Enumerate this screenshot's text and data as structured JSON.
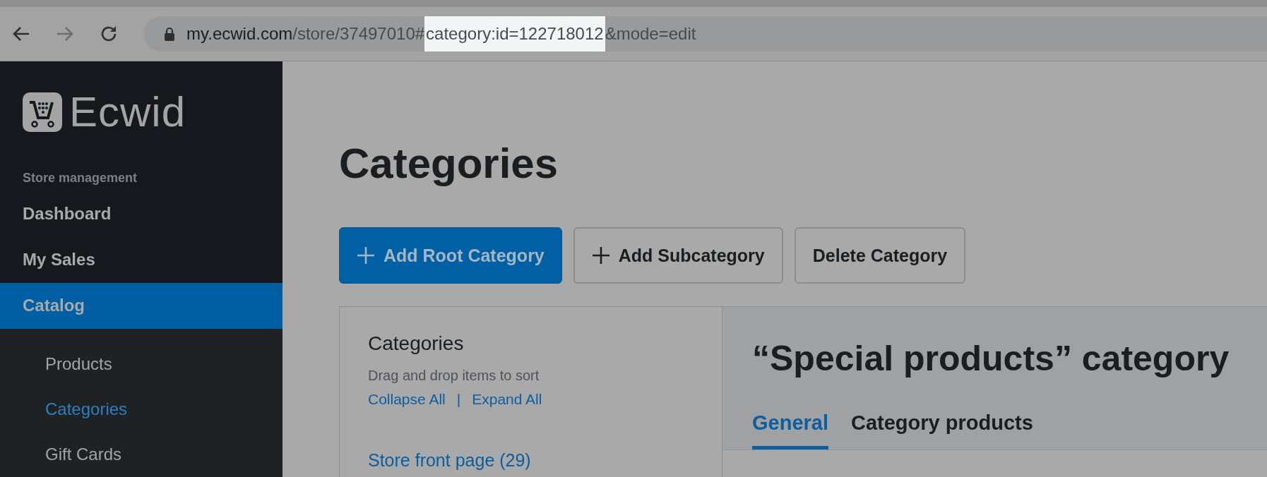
{
  "browser": {
    "url_parts": [
      {
        "text": "my.ecwid.com",
        "kind": "host"
      },
      {
        "text": "/store/37497010#",
        "kind": "path"
      },
      {
        "text": "category:id=122718012",
        "kind": "highlight"
      },
      {
        "text": "&mode=edit",
        "kind": "path"
      }
    ]
  },
  "sidebar": {
    "logo": "Ecwid",
    "section": "Store management",
    "items": [
      {
        "label": "Dashboard",
        "selected": false
      },
      {
        "label": "My Sales",
        "selected": false
      },
      {
        "label": "Catalog",
        "selected": true,
        "children": [
          {
            "label": "Products",
            "selected": false
          },
          {
            "label": "Categories",
            "selected": true
          },
          {
            "label": "Gift Cards",
            "selected": false
          }
        ]
      }
    ]
  },
  "page": {
    "title": "Categories",
    "buttons": [
      {
        "label": "Add Root Category",
        "kind": "primary",
        "plus": true
      },
      {
        "label": "Add Subcategory",
        "kind": "secondary",
        "plus": true
      },
      {
        "label": "Delete Category",
        "kind": "secondary",
        "plus": false
      }
    ],
    "tree": {
      "title": "Categories",
      "hint": "Drag and drop items to sort",
      "collapse": "Collapse All",
      "separator": "|",
      "expand": "Expand All",
      "items": [
        "Store front page (29)"
      ]
    },
    "detail": {
      "title": "“Special products” category",
      "tabs": [
        {
          "label": "General",
          "selected": true
        },
        {
          "label": "Category products",
          "selected": false
        }
      ]
    }
  }
}
